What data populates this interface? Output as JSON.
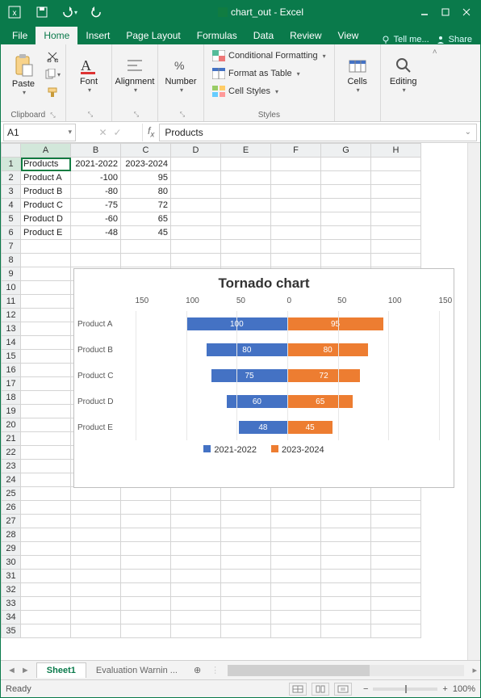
{
  "titlebar": {
    "doc_title": "chart_out - Excel"
  },
  "tabs": {
    "file": "File",
    "items": [
      "Home",
      "Insert",
      "Page Layout",
      "Formulas",
      "Data",
      "Review",
      "View"
    ],
    "active": "Home",
    "tell_me": "Tell me...",
    "share": "Share"
  },
  "ribbon": {
    "clipboard": {
      "paste": "Paste",
      "label": "Clipboard"
    },
    "font": {
      "big": "Font",
      "label": "Font"
    },
    "alignment": {
      "big": "Alignment",
      "label": ""
    },
    "number": {
      "big": "Number",
      "label": ""
    },
    "styles": {
      "cond": "Conditional Formatting",
      "table": "Format as Table",
      "cell": "Cell Styles",
      "label": "Styles"
    },
    "cells": {
      "big": "Cells"
    },
    "editing": {
      "big": "Editing"
    }
  },
  "namebox": "A1",
  "formula_value": "Products",
  "columns": [
    "A",
    "B",
    "C",
    "D",
    "E",
    "F",
    "G",
    "H"
  ],
  "rows": 35,
  "cells": {
    "A1": "Products",
    "B1": "2021-2022",
    "C1": "2023-2024",
    "A2": "Product A",
    "B2": "-100",
    "C2": "95",
    "A3": "Product B",
    "B3": "-80",
    "C3": "80",
    "A4": "Product C",
    "B4": "-75",
    "C4": "72",
    "A5": "Product D",
    "B5": "-60",
    "C5": "65",
    "A6": "Product E",
    "B6": "-48",
    "C6": "45"
  },
  "chart_data": {
    "type": "bar",
    "title": "Tornado chart",
    "categories": [
      "Product A",
      "Product B",
      "Product C",
      "Product D",
      "Product E"
    ],
    "x_ticks": [
      150,
      100,
      50,
      0,
      50,
      100,
      150
    ],
    "xlim": [
      -150,
      150
    ],
    "series": [
      {
        "name": "2021-2022",
        "values": [
          100,
          80,
          75,
          60,
          48
        ],
        "color": "#4472c4",
        "side": "left"
      },
      {
        "name": "2023-2024",
        "values": [
          95,
          80,
          72,
          65,
          45
        ],
        "color": "#ed7d31",
        "side": "right"
      }
    ]
  },
  "sheet_tabs": {
    "active": "Sheet1",
    "other": "Evaluation Warnin  ..."
  },
  "status": {
    "ready": "Ready",
    "zoom": "100%"
  }
}
